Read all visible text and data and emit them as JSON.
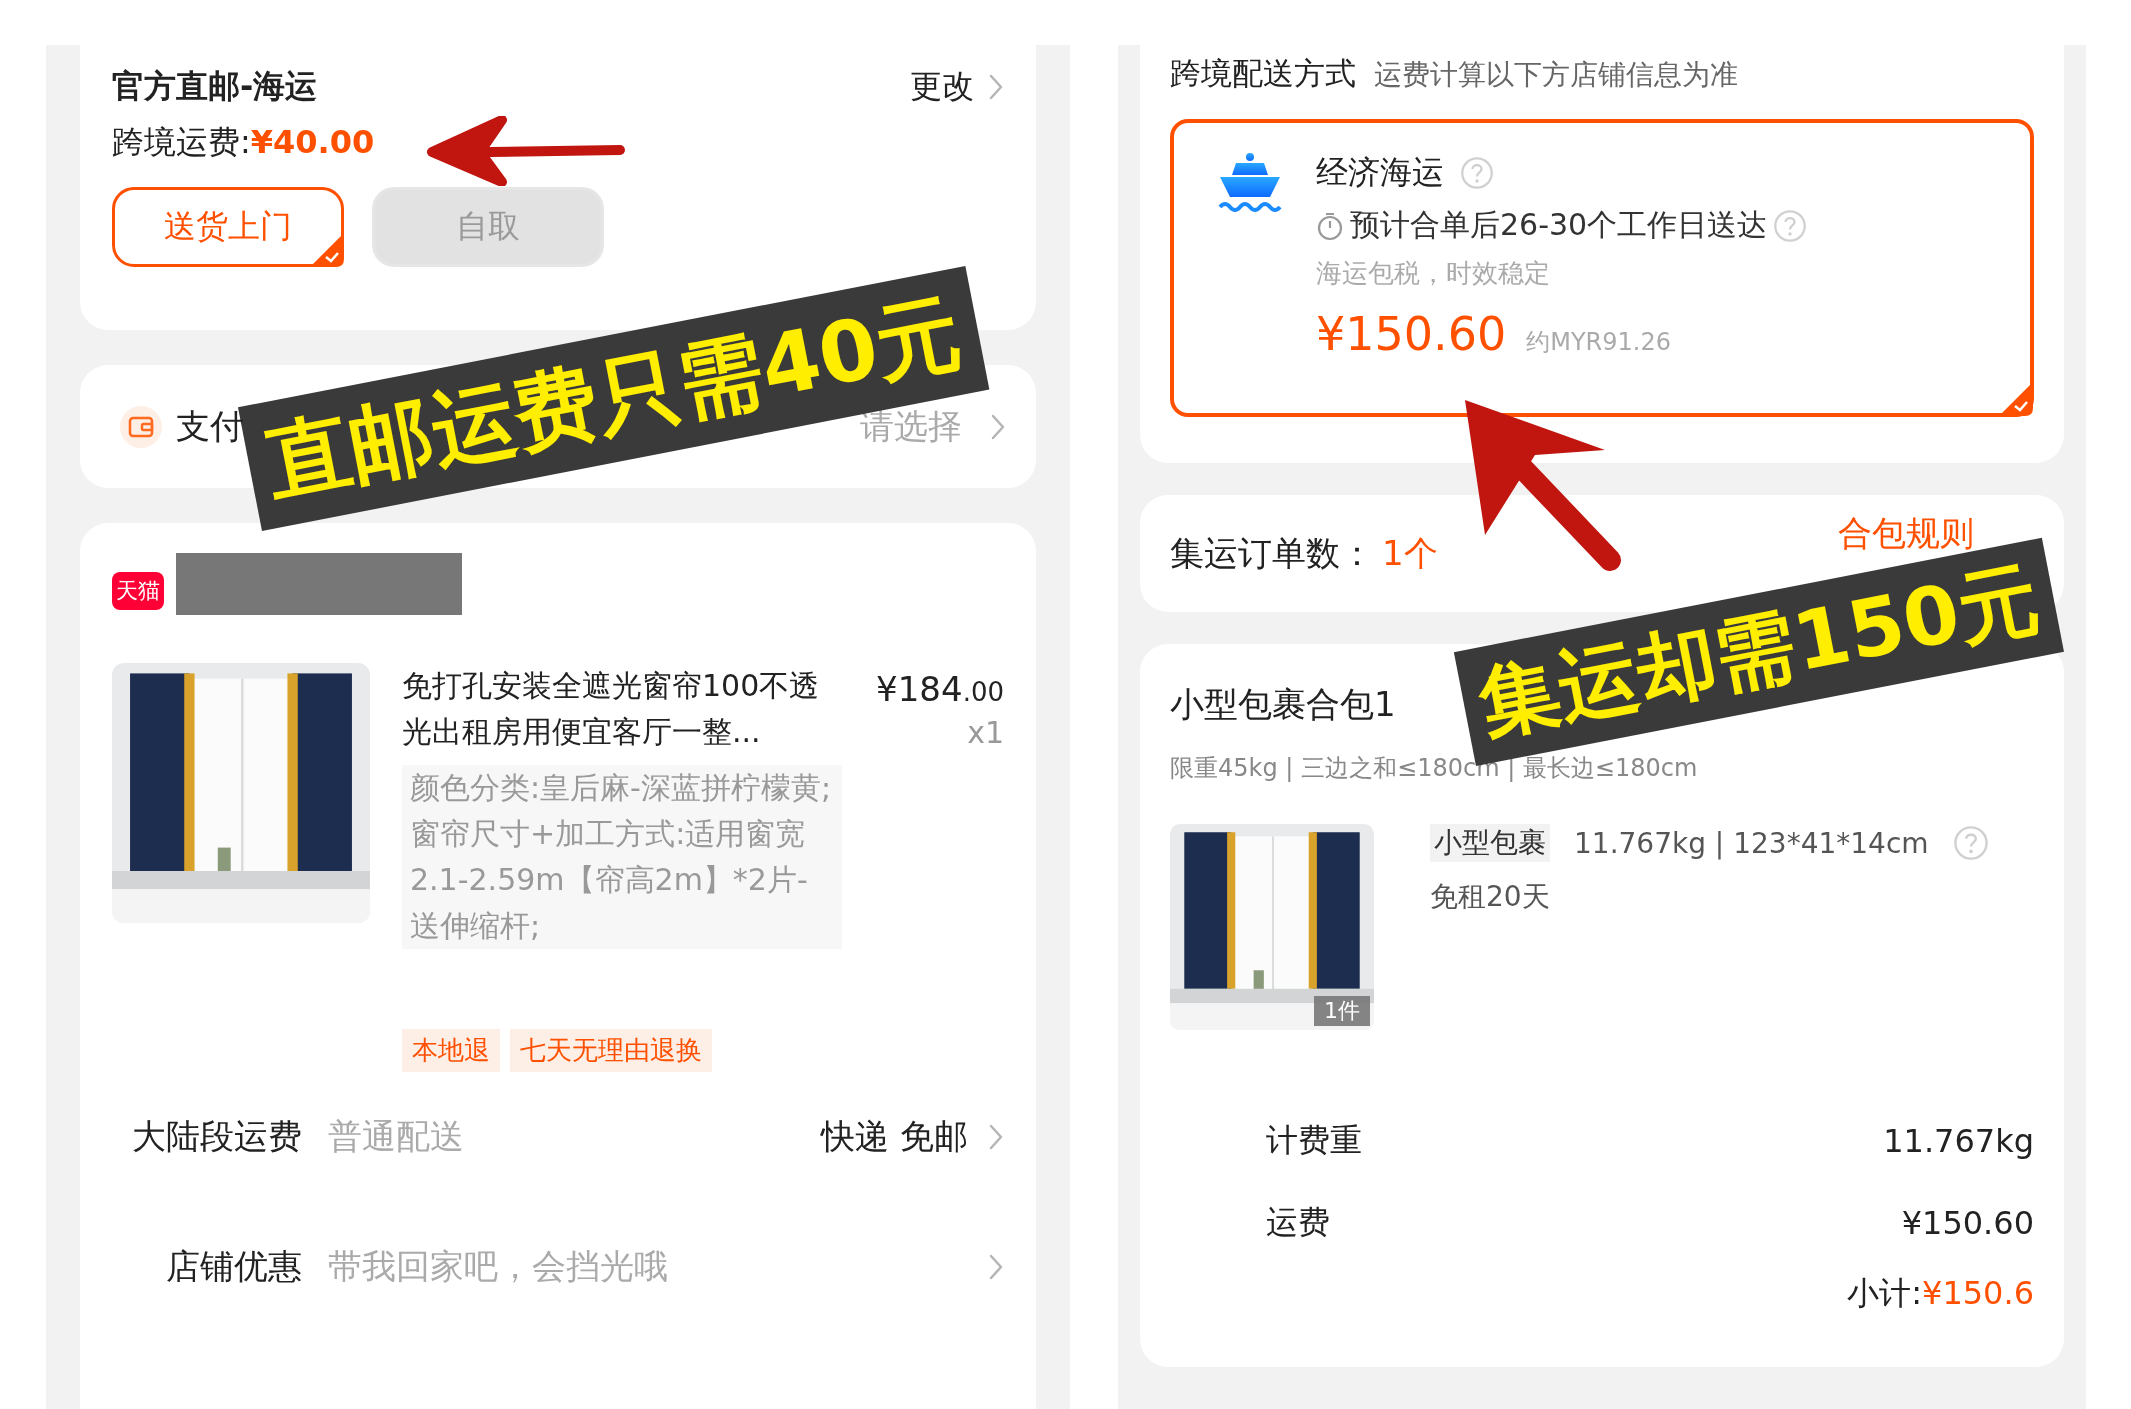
{
  "left_screen": {
    "shipping": {
      "title": "官方直邮-海运",
      "change_link": "更改",
      "fee_label": "跨境运费:",
      "fee_value": "¥40.00",
      "options": [
        {
          "label": "送货上门",
          "selected": true
        },
        {
          "label": "自取",
          "selected": false
        }
      ]
    },
    "payment": {
      "label": "支付",
      "value": "请选择"
    },
    "shop": {
      "logo_text": "天猫",
      "product": {
        "title": "免打孔安装全遮光窗帘100不透光出租房用便宜客厅一整...",
        "price": "¥184",
        "price_cents": ".00",
        "quantity": "x1",
        "spec": "颜色分类:皇后麻-深蓝拼柠檬黄;窗帘尺寸+加工方式:适用窗宽2.1-2.59m【帘高2m】*2片-送伸缩杆;",
        "tags": [
          "本地退",
          "七天无理由退换"
        ]
      },
      "rows": [
        {
          "label": "大陆段运费",
          "value": "普通配送",
          "right": "快递 免邮"
        },
        {
          "label": "店铺优惠",
          "value": "带我回家吧，会挡光哦",
          "right": ""
        }
      ]
    }
  },
  "right_screen": {
    "shipping": {
      "title": "跨境配送方式",
      "note": "运费计算以下方店铺信息为准",
      "option": {
        "name": "经济海运",
        "eta": "预计合单后26-30个工作日送达",
        "desc": "海运包税，时效稳定",
        "price": "¥150.60",
        "approx": "约MYR91.26",
        "selected": true
      }
    },
    "orders": {
      "label": "集运订单数：",
      "count": "1个",
      "rules_link": "合包规则"
    },
    "package": {
      "title": "小型包裹合包1",
      "limits": "限重45kg | 三边之和≤180cm | 最长边≤180cm",
      "item": {
        "count_badge": "1件",
        "type_tag": "小型包裹",
        "specs": "11.767kg | 123*41*14cm",
        "free_storage": "免租20天"
      },
      "summary": [
        {
          "label": "计费重",
          "value": "11.767kg"
        },
        {
          "label": "运费",
          "value": "¥150.60"
        }
      ],
      "subtotal_label": "小计:",
      "subtotal_value": "¥150.6"
    }
  },
  "annotations": [
    {
      "text": "直邮运费只需40元"
    },
    {
      "text": "集运却需150元"
    }
  ]
}
